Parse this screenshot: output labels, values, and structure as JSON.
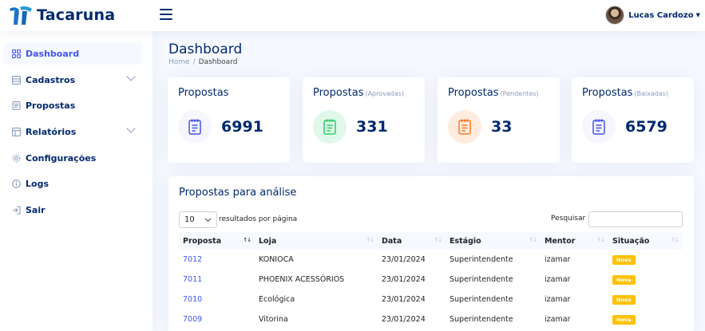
{
  "app": {
    "name": "Tacaruna"
  },
  "header": {
    "user_name": "Lucas Cardozo"
  },
  "sidebar": {
    "items": [
      {
        "label": "Dashboard",
        "icon": "grid-icon",
        "active": true
      },
      {
        "label": "Cadastros",
        "icon": "cadastros-icon",
        "expandable": true
      },
      {
        "label": "Propostas",
        "icon": "document-icon"
      },
      {
        "label": "Relatórios",
        "icon": "table-icon",
        "expandable": true
      },
      {
        "label": "Configurações",
        "icon": "gear-icon"
      },
      {
        "label": "Logs",
        "icon": "info-icon"
      },
      {
        "label": "Sair",
        "icon": "logout-icon"
      }
    ]
  },
  "page": {
    "title": "Dashboard",
    "breadcrumb": [
      "Home",
      "Dashboard"
    ]
  },
  "cards": [
    {
      "title": "Propostas",
      "subtitle": "",
      "value": "6991",
      "icon": "notes-icon",
      "accent": "#4154f1",
      "bg": "#f6f6fe"
    },
    {
      "title": "Propostas",
      "subtitle": "(Aprovadas)",
      "value": "331",
      "icon": "notes-icon",
      "accent": "#2eca6a",
      "bg": "#e0f8e9"
    },
    {
      "title": "Propostas",
      "subtitle": "(Pendentes)",
      "value": "33",
      "icon": "notes-icon",
      "accent": "#ff771d",
      "bg": "#ffecdf"
    },
    {
      "title": "Propostas",
      "subtitle": "(Baixadas)",
      "value": "6579",
      "icon": "notes-icon",
      "accent": "#4154f1",
      "bg": "#f6f6fe"
    }
  ],
  "table": {
    "title": "Propostas para análise",
    "page_length": "10",
    "length_suffix": "resultados por página",
    "search_label": "Pesquisar",
    "columns": [
      "Proposta",
      "Loja",
      "Data",
      "Estágio",
      "Mentor",
      "Situação"
    ],
    "rows": [
      {
        "proposta": "7012",
        "loja": "KONIOCA",
        "data": "23/01/2024",
        "estagio": "Superintendente",
        "mentor": "izamar",
        "situacao": "Nova"
      },
      {
        "proposta": "7011",
        "loja": "PHOENIX ACESSÓRIOS",
        "data": "23/01/2024",
        "estagio": "Superintendente",
        "mentor": "izamar",
        "situacao": "Nova"
      },
      {
        "proposta": "7010",
        "loja": "Ecológica",
        "data": "23/01/2024",
        "estagio": "Superintendente",
        "mentor": "izamar",
        "situacao": "Nova"
      },
      {
        "proposta": "7009",
        "loja": "Vitorina",
        "data": "23/01/2024",
        "estagio": "Superintendente",
        "mentor": "izamar",
        "situacao": "Nova"
      }
    ]
  },
  "colors": {
    "primary": "#4154f1",
    "navy": "#012970",
    "badge": "#ffc107"
  }
}
